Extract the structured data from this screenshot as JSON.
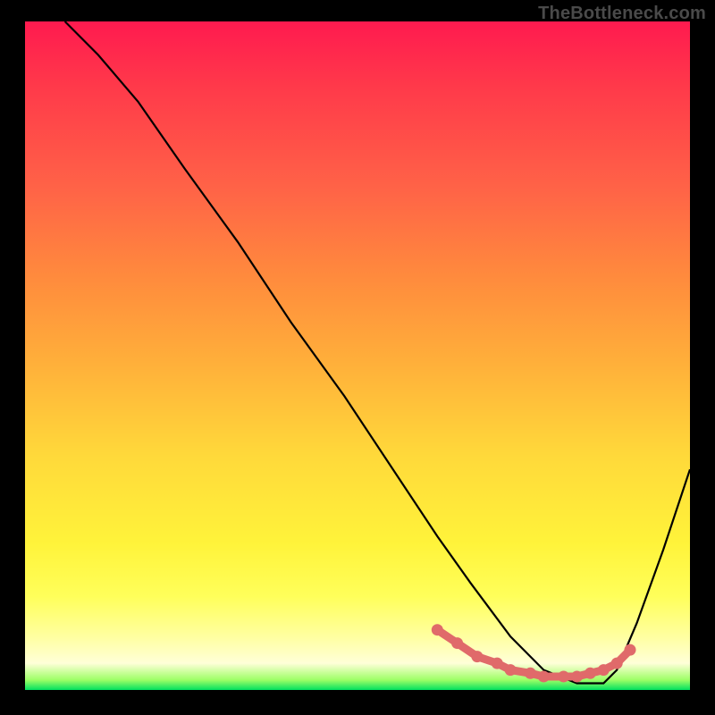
{
  "watermark": {
    "text": "TheBottleneck.com"
  },
  "chart_data": {
    "type": "line",
    "title": "",
    "xlabel": "",
    "ylabel": "",
    "xlim": [
      0,
      100
    ],
    "ylim": [
      0,
      100
    ],
    "grid": false,
    "legend": false,
    "series": [
      {
        "name": "black-curve",
        "stroke": "#000000",
        "x": [
          6,
          11,
          17,
          24,
          32,
          40,
          48,
          56,
          62,
          67,
          73,
          78,
          83,
          87,
          89,
          92,
          96,
          100
        ],
        "y": [
          100,
          95,
          88,
          78,
          67,
          55,
          44,
          32,
          23,
          16,
          8,
          3,
          1,
          1,
          3,
          10,
          21,
          33
        ]
      },
      {
        "name": "pink-markers",
        "stroke": "#e06a6a",
        "marker": "circle",
        "x": [
          62,
          65,
          68,
          71,
          73,
          76,
          78,
          81,
          83,
          85,
          87,
          89,
          91
        ],
        "y": [
          9,
          7,
          5,
          4,
          3,
          2.5,
          2,
          2,
          2,
          2.5,
          3,
          4,
          6
        ]
      }
    ]
  }
}
